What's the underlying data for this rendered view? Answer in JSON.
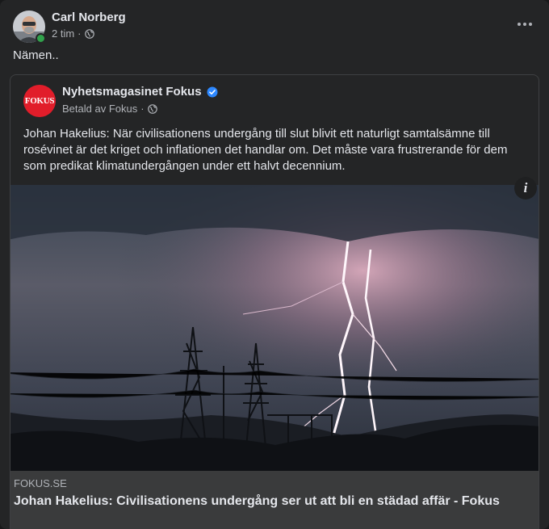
{
  "post": {
    "author": "Carl Norberg",
    "time": "2 tim",
    "separator": "·",
    "text": "Nämen.."
  },
  "shared": {
    "page_name": "Nyhetsmagasinet Fokus",
    "logo_text": "FOKUS",
    "sponsored": "Betald av Fokus",
    "separator": "·",
    "body": "Johan Hakelius: När civilisationens undergång till slut blivit ett naturligt samtalsämne till rosévinet är det kriget och inflationen det handlar om. Det måste vara frustrerande för dem som predikat klimatundergången under ett halvt decennium.",
    "info_label": "i",
    "link": {
      "domain": "FOKUS.SE",
      "title": "Johan Hakelius: Civilisationens undergång ser ut att bli en städad affär - Fokus"
    }
  },
  "icons": [
    "avatar",
    "globe-icon",
    "more-options-icon",
    "verified-badge-icon",
    "info-icon"
  ],
  "colors": {
    "background": "#242526",
    "text": "#e4e6eb",
    "secondary": "#b0b3b8",
    "verified": "#2d88ff",
    "online": "#31a24c",
    "brand": "#e11d2a"
  }
}
